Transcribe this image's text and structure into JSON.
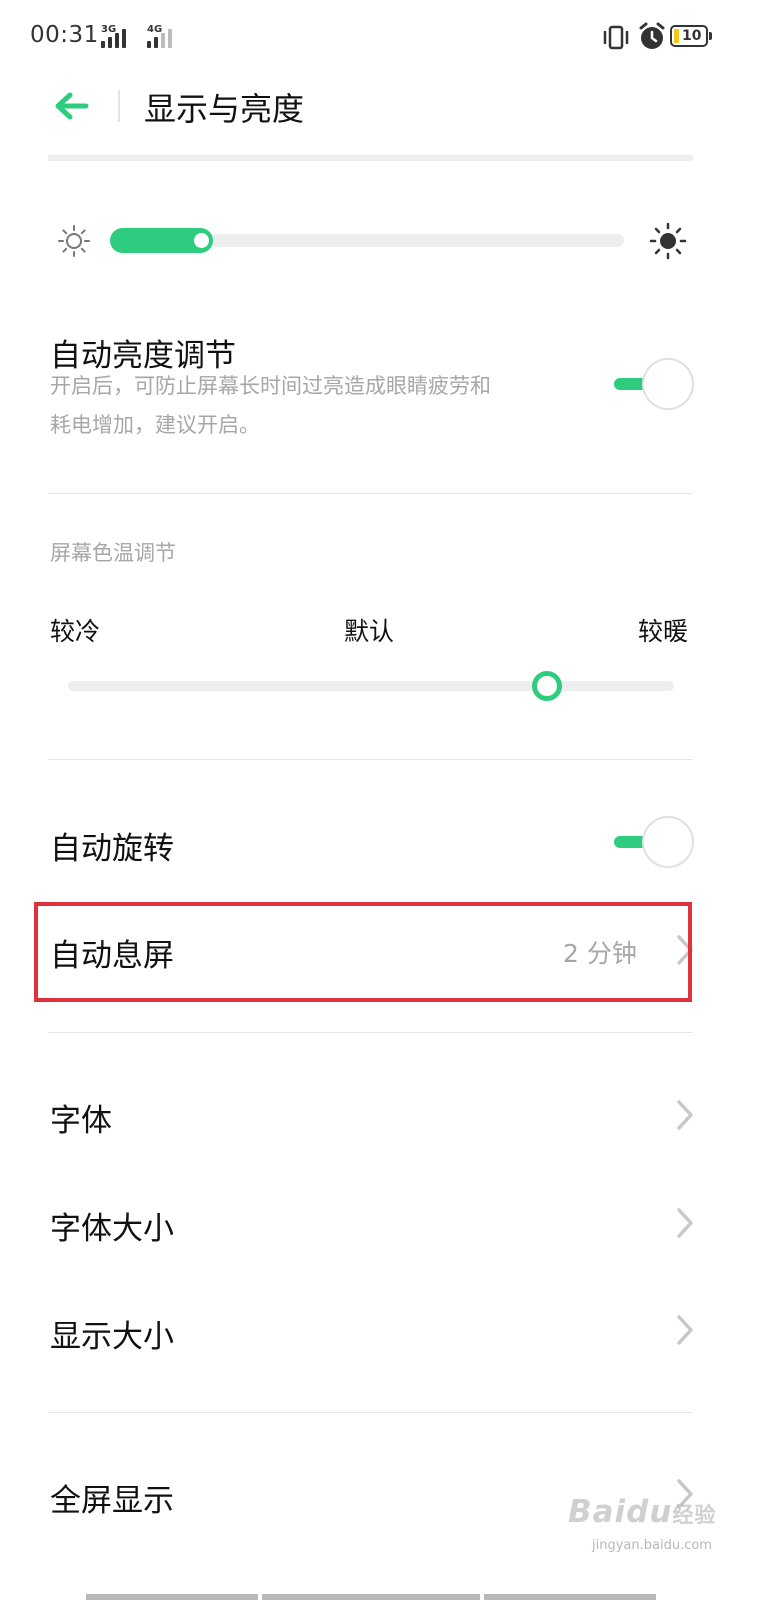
{
  "status_bar": {
    "time": "00:31",
    "network1": "3G",
    "network2": "4G",
    "battery": "10"
  },
  "header": {
    "title": "显示与亮度"
  },
  "brightness": {
    "level": 0.2
  },
  "auto_brightness": {
    "title": "自动亮度调节",
    "desc_line1": "开启后，可防止屏幕长时间过亮造成眼睛疲劳和",
    "desc_line2": "耗电增加，建议开启。",
    "enabled": true
  },
  "color_temp": {
    "section_label": "屏幕色温调节",
    "cool_label": "较冷",
    "default_label": "默认",
    "warm_label": "较暖",
    "level": 0.79
  },
  "auto_rotate": {
    "title": "自动旋转",
    "enabled": true
  },
  "auto_sleep": {
    "title": "自动息屏",
    "value": "2 分钟"
  },
  "menu": {
    "font": "字体",
    "font_size": "字体大小",
    "display_size": "显示大小",
    "fullscreen": "全屏显示"
  },
  "watermark": {
    "logo": "Baidu",
    "logo_cn": "经验",
    "url": "jingyan.baidu.com"
  },
  "colors": {
    "accent": "#2ecc7e",
    "highlight": "#e0323b"
  }
}
